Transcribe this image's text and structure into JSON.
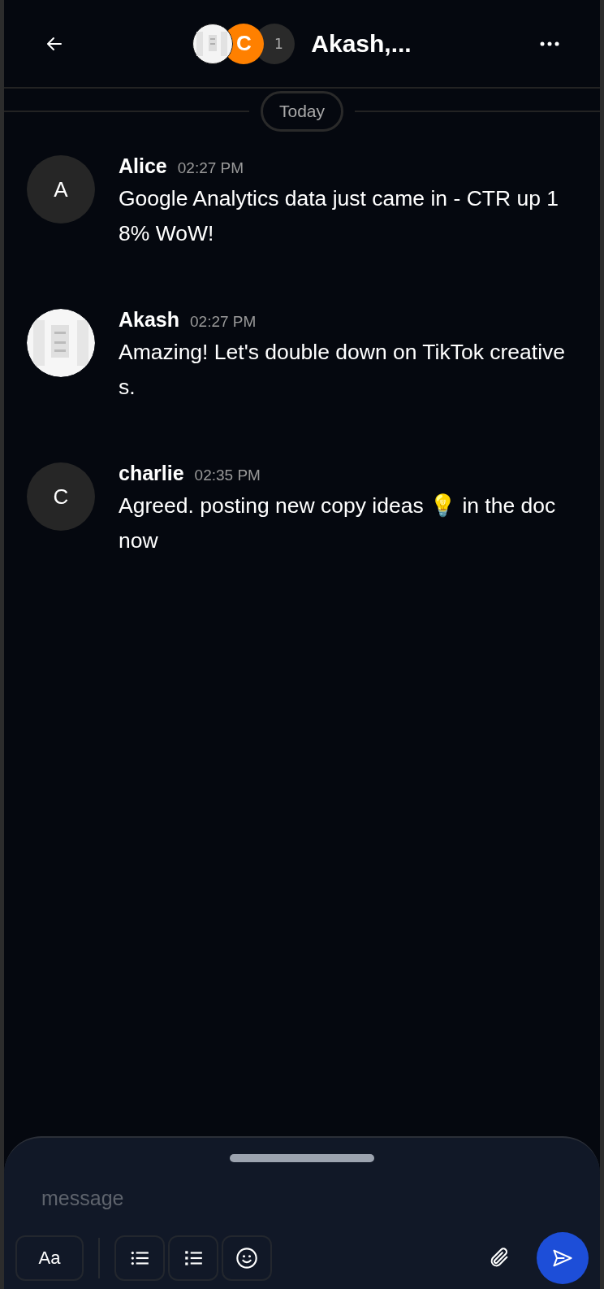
{
  "header": {
    "avatars": [
      {
        "kind": "picture"
      },
      {
        "kind": "letter",
        "initial": "C",
        "color": "#ff8000"
      },
      {
        "kind": "count",
        "text": "1",
        "color": "#2a2a2a"
      }
    ],
    "title": "Akash,..."
  },
  "date_divider": "Today",
  "messages": [
    {
      "avatar": {
        "kind": "letter",
        "initial": "A",
        "color": "#262626"
      },
      "sender": "Alice",
      "time": "02:27 PM",
      "text": "Google Analytics data just came in - CTR up 18% WoW!"
    },
    {
      "avatar": {
        "kind": "picture"
      },
      "sender": "Akash",
      "time": "02:27 PM",
      "text": "Amazing! Let's double down on TikTok creatives."
    },
    {
      "avatar": {
        "kind": "letter",
        "initial": "C",
        "color": "#262626"
      },
      "sender": "charlie",
      "time": "02:35 PM",
      "text": "Agreed. posting new copy ideas 💡 in the doc now"
    }
  ],
  "composer": {
    "placeholder": "message",
    "format_button": "Aa"
  }
}
